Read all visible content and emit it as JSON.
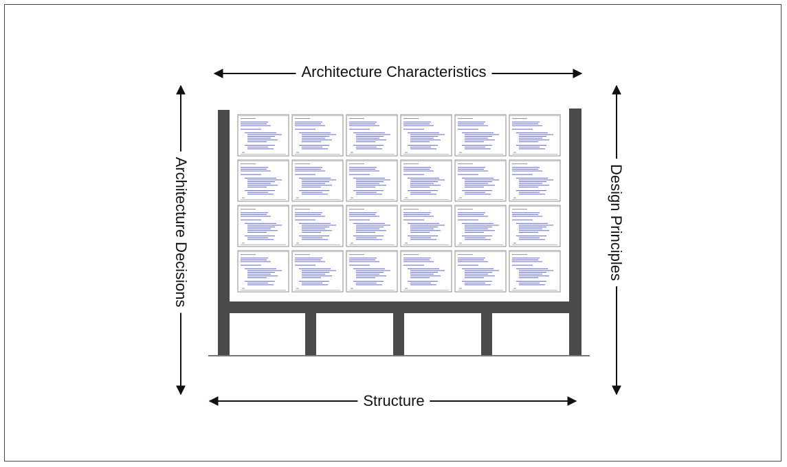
{
  "labels": {
    "top": "Architecture Characteristics",
    "bottom": "Structure",
    "left": "Architecture Decisions",
    "right": "Design Principles"
  },
  "colors": {
    "structure": "#4a4a4a",
    "arrow": "#111111",
    "thumb_code": "#6b72d8"
  },
  "code_grid": {
    "rows": 4,
    "cols": 6
  }
}
